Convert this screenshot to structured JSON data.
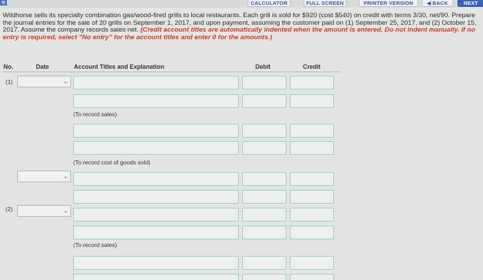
{
  "toolbar": {
    "calculator": "CALCULATOR",
    "full_screen": "FULL SCREEN",
    "printer_version": "PRINTER VERSION",
    "back": "◀ BACK",
    "next": "NEXT"
  },
  "problem": {
    "text": "Wildhorse sells its specialty combination gas/wood-fired grills to local restaurants. Each grill is sold for $920 (cost $540) on credit with terms 3/30, net/90. Prepare the journal entries for the sale of 20 grills on September 1, 2017, and upon payment, assuming the customer paid on (1) September 25, 2017, and (2) October 15, 2017. Assume the company records sales net. ",
    "warning": "(Credit account titles are automatically indented when the amount is entered. Do not indent manually. If no entry is required, select \"No entry\" for the account titles and enter 0 for the amounts.)"
  },
  "table": {
    "headers": {
      "no": "No.",
      "date": "Date",
      "account": "Account Titles and Explanation",
      "debit": "Debit",
      "credit": "Credit"
    },
    "entry1_label": "(1)",
    "entry2_label": "(2)",
    "note_sales_1": "(To record sales)",
    "note_cogs": "(To record cost of goods sold)",
    "note_sales_2": "(To record sales)"
  },
  "icons": {
    "dropdown": "chevron-down-icon"
  }
}
